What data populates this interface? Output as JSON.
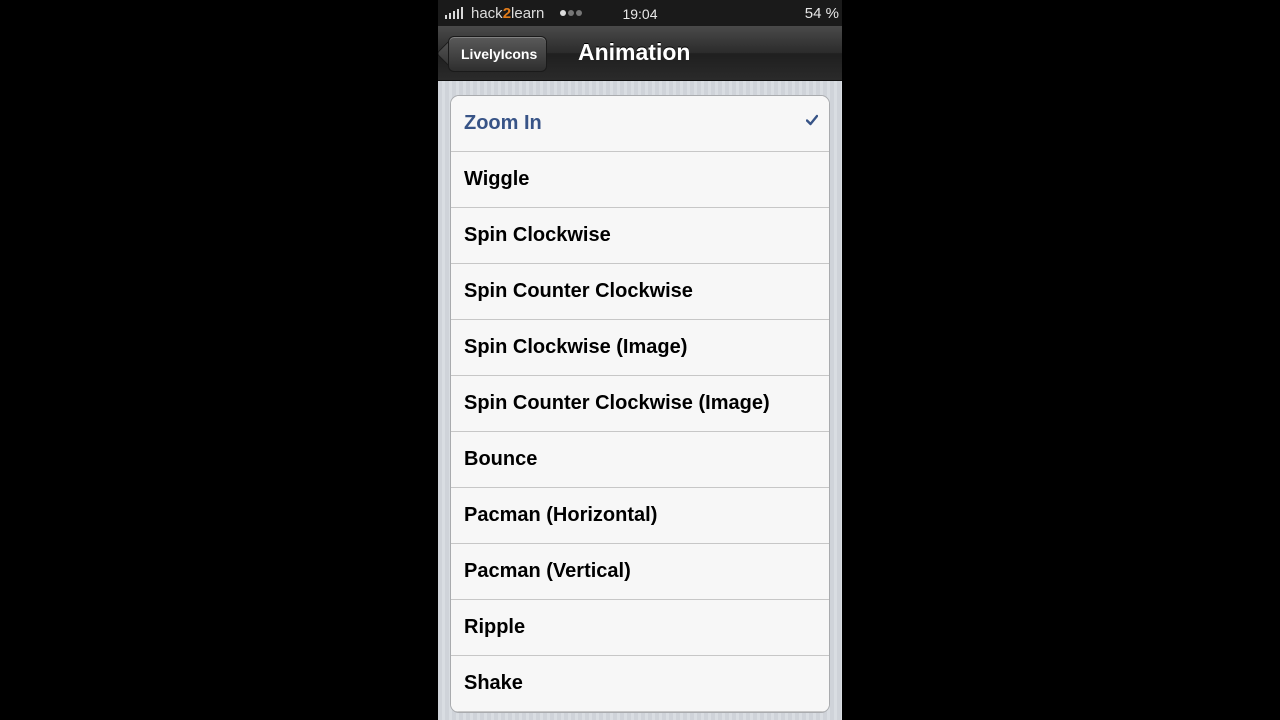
{
  "status_bar": {
    "carrier_prefix": "hack",
    "carrier_accent": "2",
    "carrier_suffix": "learn",
    "time": "19:04",
    "battery": "54 %"
  },
  "nav": {
    "back_label": "LivelyIcons",
    "title": "Animation"
  },
  "colors": {
    "selected_text": "#385487",
    "carrier_accent": "#e07b1a"
  },
  "options": [
    {
      "label": "Zoom In",
      "selected": true
    },
    {
      "label": "Wiggle",
      "selected": false
    },
    {
      "label": "Spin Clockwise",
      "selected": false
    },
    {
      "label": "Spin Counter Clockwise",
      "selected": false
    },
    {
      "label": "Spin Clockwise (Image)",
      "selected": false
    },
    {
      "label": "Spin Counter Clockwise (Image)",
      "selected": false
    },
    {
      "label": "Bounce",
      "selected": false
    },
    {
      "label": "Pacman (Horizontal)",
      "selected": false
    },
    {
      "label": "Pacman (Vertical)",
      "selected": false
    },
    {
      "label": "Ripple",
      "selected": false
    },
    {
      "label": "Shake",
      "selected": false
    }
  ]
}
